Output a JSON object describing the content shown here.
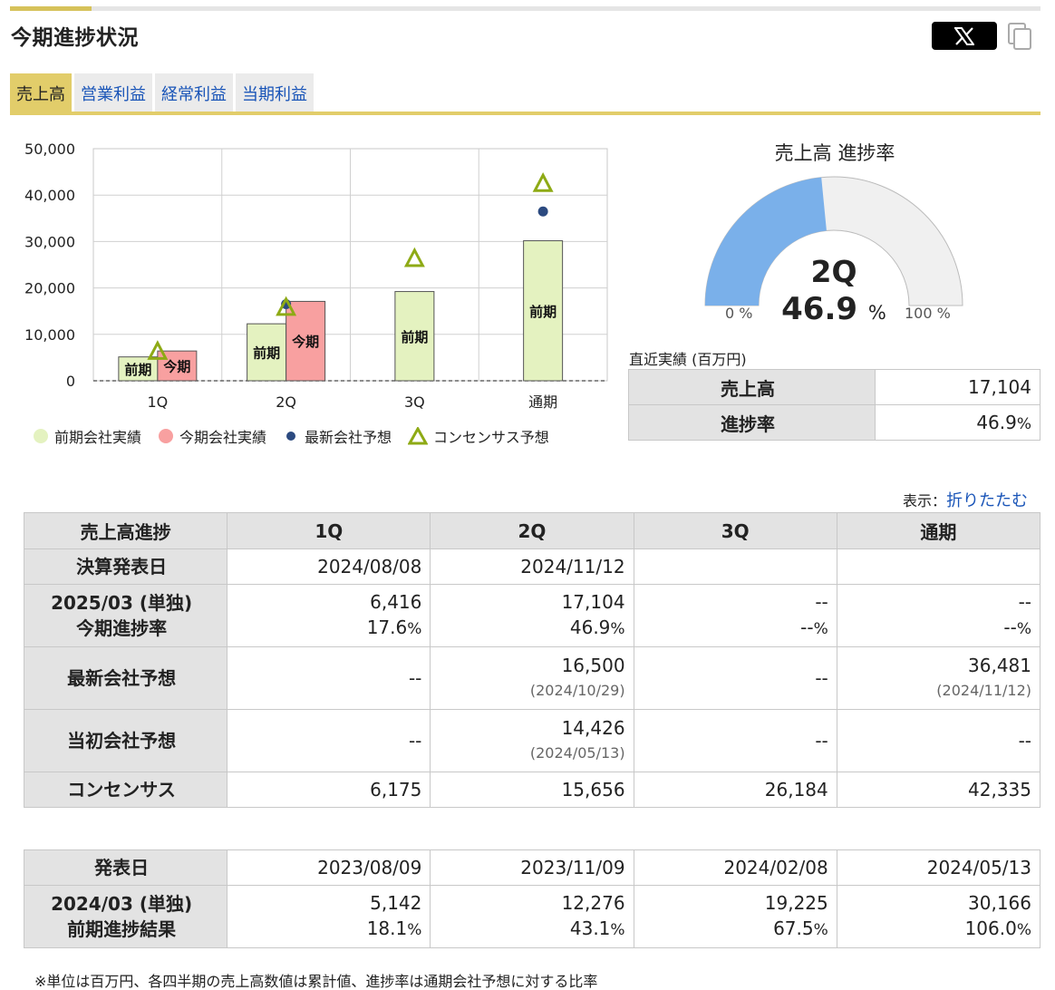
{
  "title": "今期進捗状況",
  "tabs": [
    {
      "label": "売上高",
      "active": true
    },
    {
      "label": "営業利益",
      "active": false
    },
    {
      "label": "経常利益",
      "active": false
    },
    {
      "label": "当期利益",
      "active": false
    }
  ],
  "chart_data": {
    "type": "bar",
    "categories": [
      "1Q",
      "2Q",
      "3Q",
      "通期"
    ],
    "ylim": [
      0,
      50000
    ],
    "yticks": [
      "50,000",
      "40,000",
      "30,000",
      "20,000",
      "10,000",
      "0"
    ],
    "series": [
      {
        "name": "前期会社実績",
        "values": [
          5142,
          12276,
          19225,
          30166
        ],
        "color": "#e4f2c0",
        "bar_label": "前期"
      },
      {
        "name": "今期会社実績",
        "values": [
          6416,
          17104,
          null,
          null
        ],
        "color": "#f8a0a0",
        "bar_label": "今期"
      },
      {
        "name": "最新会社予想",
        "values": [
          null,
          16500,
          null,
          36481
        ],
        "color": "#2c4a80"
      },
      {
        "name": "コンセンサス予想",
        "values": [
          6175,
          15656,
          26184,
          42335
        ],
        "color": "#8eaa15"
      }
    ]
  },
  "gauge": {
    "title": "売上高 進捗率",
    "quarter": "2Q",
    "value": "46.9",
    "percent": 46.9,
    "unit": "%",
    "min_label": "0 %",
    "max_label": "100 %",
    "fill_color": "#7ab0ea",
    "track_color": "#f0f0f0"
  },
  "recent": {
    "label": "直近実績 (百万円)",
    "rows": [
      {
        "label": "売上高",
        "value": "17,104",
        "unit": ""
      },
      {
        "label": "進捗率",
        "value": "46.9",
        "unit": "%"
      }
    ]
  },
  "display_toggle": {
    "label": "表示：",
    "link": "折りたたむ"
  },
  "progress_table": {
    "header": [
      "売上高進捗",
      "1Q",
      "2Q",
      "3Q",
      "通期"
    ],
    "announce_label": "決算発表日",
    "announce": [
      "2024/08/08",
      "2024/11/12",
      "",
      ""
    ],
    "current_label_1": "2025/03 (単独)",
    "current_label_2": "今期進捗率",
    "current_values": [
      "6,416",
      "17,104",
      "--",
      "--"
    ],
    "current_rates": [
      "17.6",
      "46.9",
      "--",
      "--"
    ],
    "latest_label": "最新会社予想",
    "latest_values": [
      "--",
      "16,500",
      "--",
      "36,481"
    ],
    "latest_dates": [
      "",
      "(2024/10/29)",
      "",
      "(2024/11/12)"
    ],
    "initial_label": "当初会社予想",
    "initial_values": [
      "--",
      "14,426",
      "--",
      "--"
    ],
    "initial_dates": [
      "",
      "(2024/05/13)",
      "",
      ""
    ],
    "consensus_label": "コンセンサス",
    "consensus_values": [
      "6,175",
      "15,656",
      "26,184",
      "42,335"
    ]
  },
  "prev_table": {
    "announce_label": "発表日",
    "announce": [
      "2023/08/09",
      "2023/11/09",
      "2024/02/08",
      "2024/05/13"
    ],
    "label_1": "2024/03 (単独)",
    "label_2": "前期進捗結果",
    "values": [
      "5,142",
      "12,276",
      "19,225",
      "30,166"
    ],
    "rates": [
      "18.1",
      "43.1",
      "67.5",
      "106.0"
    ]
  },
  "pct_unit": "%",
  "footnote": "※単位は百万円、各四半期の売上高数値は累計値、進捗率は通期会社予想に対する比率"
}
